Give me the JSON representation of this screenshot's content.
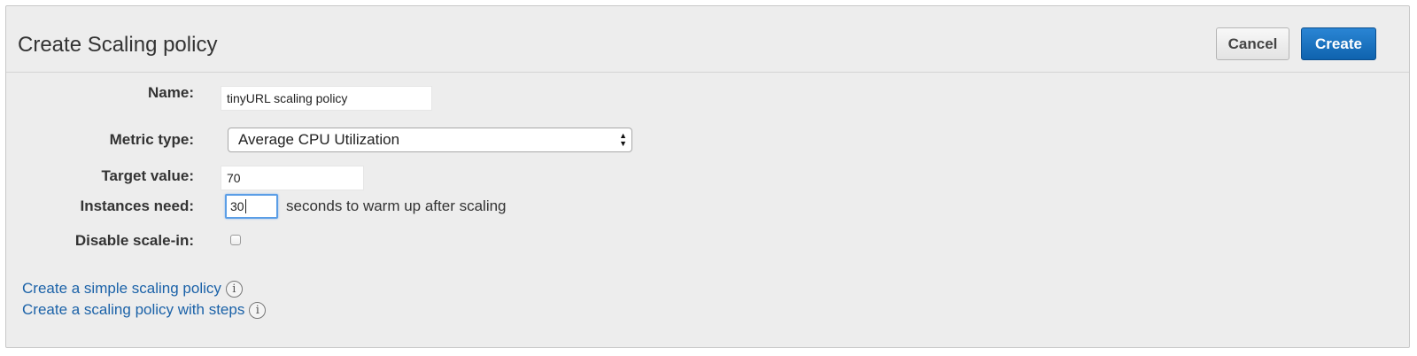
{
  "header": {
    "title": "Create Scaling policy",
    "cancel_label": "Cancel",
    "create_label": "Create"
  },
  "form": {
    "name": {
      "label": "Name:",
      "value": "tinyURL scaling policy"
    },
    "metric_type": {
      "label": "Metric type:",
      "selected": "Average CPU Utilization"
    },
    "target_value": {
      "label": "Target value:",
      "value": "70"
    },
    "instances_need": {
      "label": "Instances need:",
      "value": "30",
      "suffix": "seconds to warm up after scaling"
    },
    "disable_scale_in": {
      "label": "Disable scale-in:",
      "checked": false
    }
  },
  "links": [
    {
      "label": "Create a simple scaling policy",
      "icon": "info-icon"
    },
    {
      "label": "Create a scaling policy with steps",
      "icon": "info-icon"
    }
  ],
  "colors": {
    "primary_button": "#1a73c4",
    "link": "#1b62a8",
    "focus_ring": "#5b9ee6",
    "panel_background": "#ededed"
  }
}
